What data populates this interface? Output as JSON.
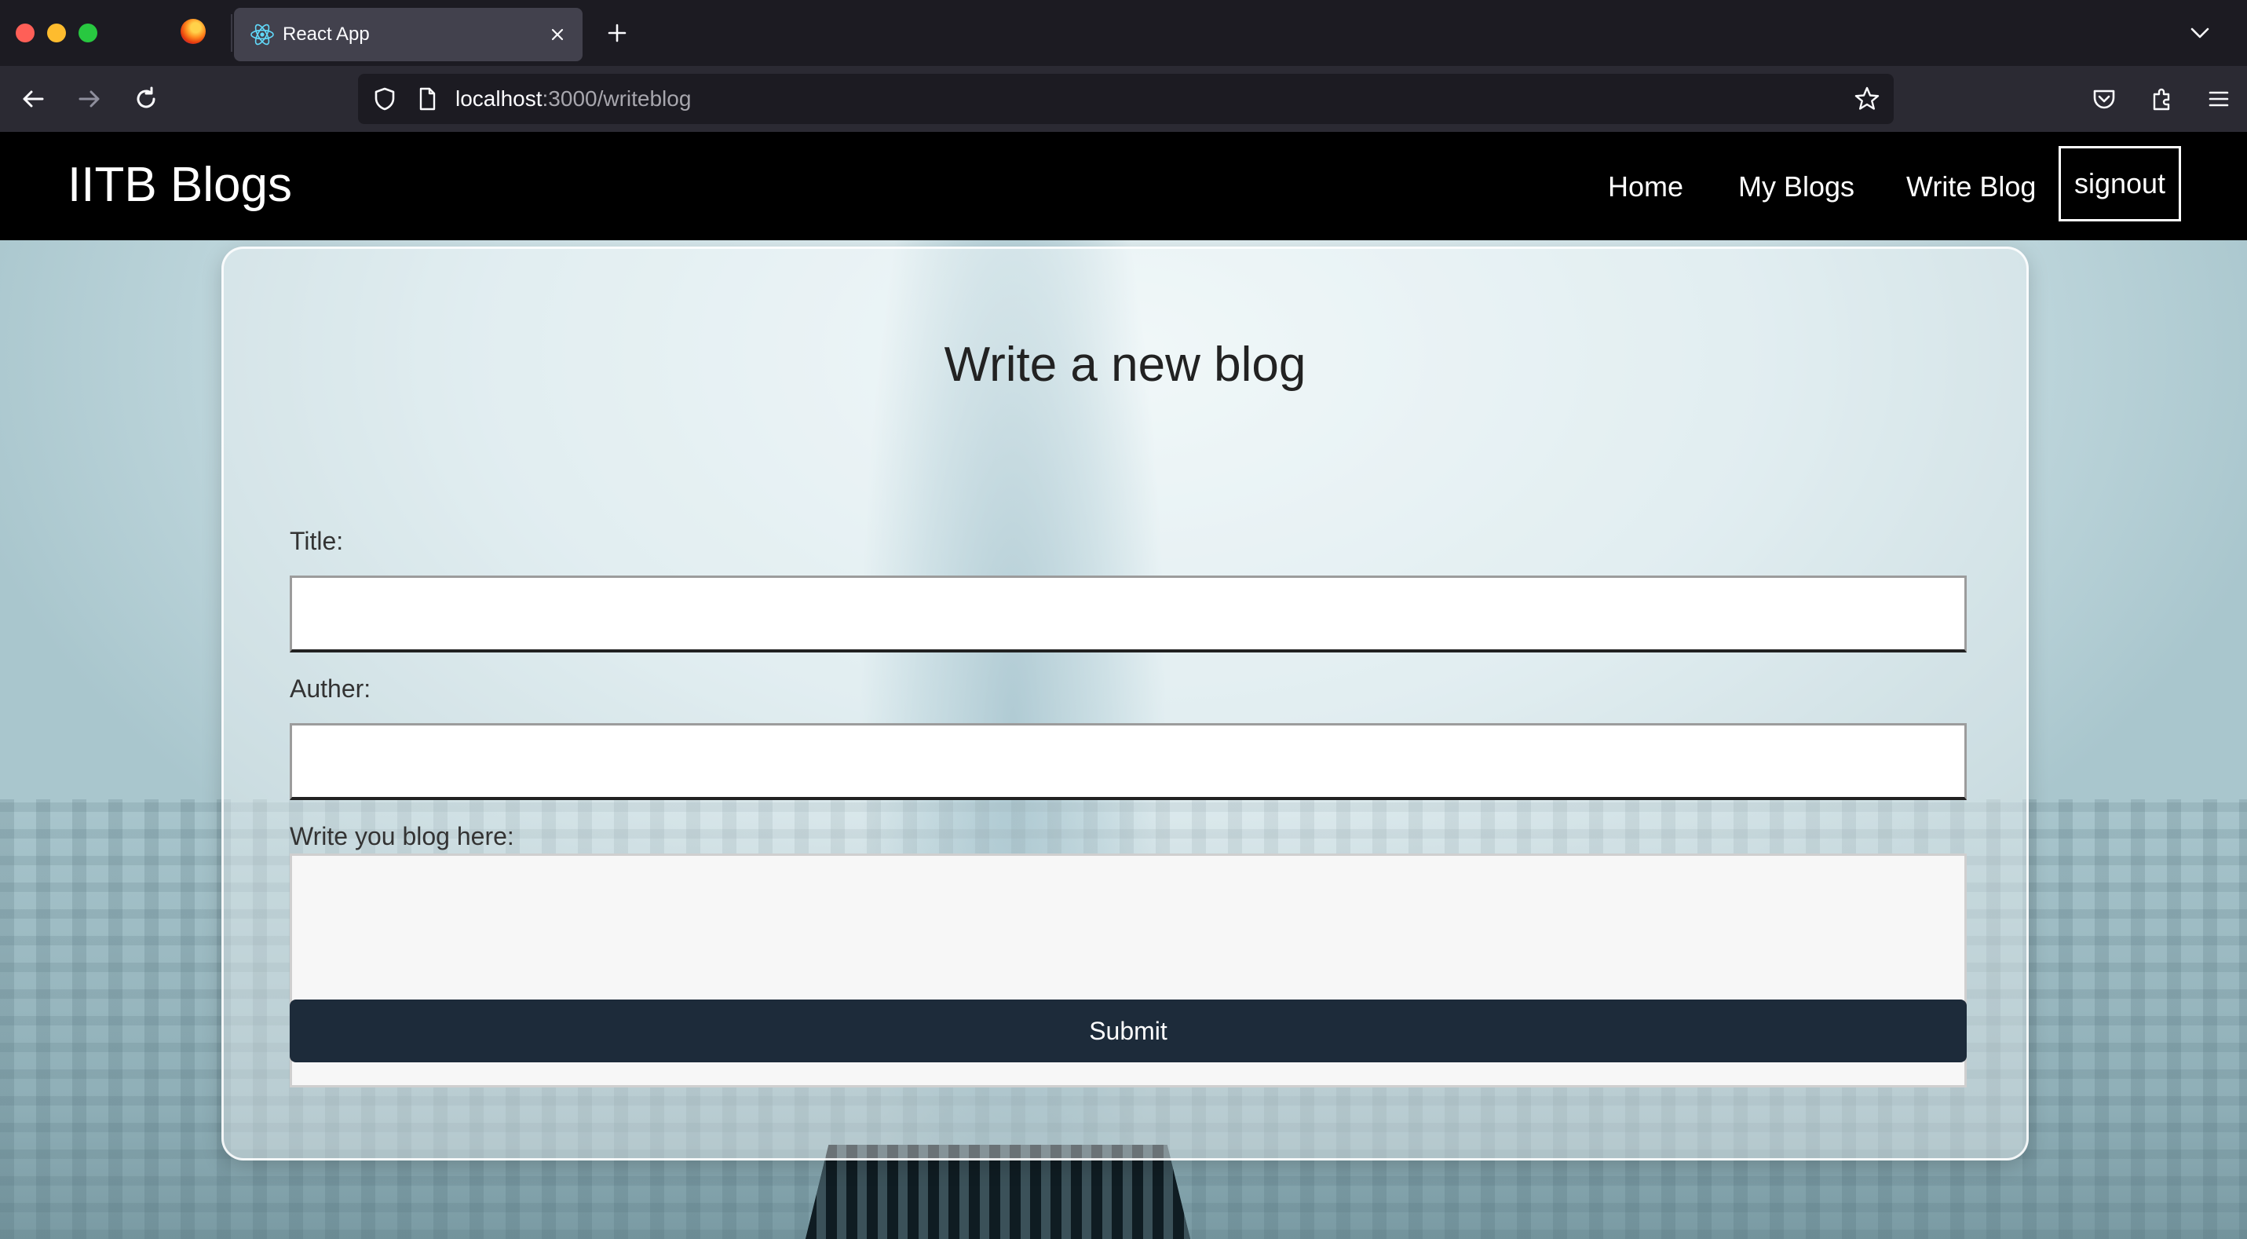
{
  "browser": {
    "tab_title": "React App",
    "url_host": "localhost",
    "url_path": ":3000/writeblog"
  },
  "header": {
    "brand": "IITB Blogs",
    "nav": {
      "home": "Home",
      "my_blogs": "My Blogs",
      "write_blog": "Write Blog",
      "signout": "signout"
    }
  },
  "form": {
    "heading": "Write a new blog",
    "title_label": "Title:",
    "title_value": "",
    "author_label": "Auther:",
    "author_value": "",
    "body_label": "Write you blog here:",
    "body_value": "",
    "submit_label": "Submit"
  },
  "colors": {
    "header_bg": "#000000",
    "submit_bg": "#1d2b3a"
  }
}
